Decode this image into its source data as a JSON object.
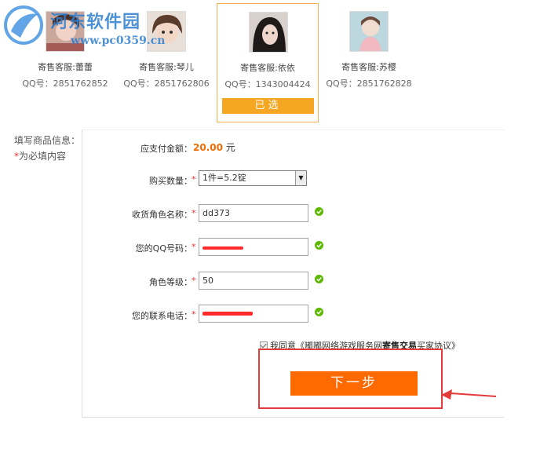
{
  "watermark": {
    "title": "河东软件园",
    "url": "www.pc0359.cn"
  },
  "agents": [
    {
      "name": "寄售客服:蕾蕾",
      "qq": "QQ号：2851762852",
      "selected": false
    },
    {
      "name": "寄售客服:琴儿",
      "qq": "QQ号：2851762806",
      "selected": false
    },
    {
      "name": "寄售客服:依依",
      "qq": "QQ号：1343004424",
      "selected": true
    },
    {
      "name": "寄售客服:苏樱",
      "qq": "QQ号：2851762828",
      "selected": false
    }
  ],
  "selected_label": "已选",
  "side": {
    "title": "填写商品信息：",
    "note_star": "*",
    "note_text": "为必填内容"
  },
  "form": {
    "amount_label": "应支付金额：",
    "amount_value": "20.00",
    "amount_unit": "元",
    "required_mark": "*",
    "quantity_label": "购买数量：",
    "quantity_value": "1件=5.2锭",
    "role_name_label": "收货角色名称：",
    "role_name_value": "dd373",
    "qq_label": "您的QQ号码：",
    "level_label": "角色等级：",
    "level_value": "50",
    "phone_label": "您的联系电话："
  },
  "agree": {
    "prefix": "我同意《",
    "name": "嘟嘟网络游戏服务网",
    "bold": "寄售交易",
    "suffix": "买家协议》"
  },
  "next_label": "下一步",
  "colors": {
    "accent": "#ff6a00",
    "selected": "#f5a623",
    "annotation": "#e33a3a",
    "ok": "#5cb800"
  }
}
